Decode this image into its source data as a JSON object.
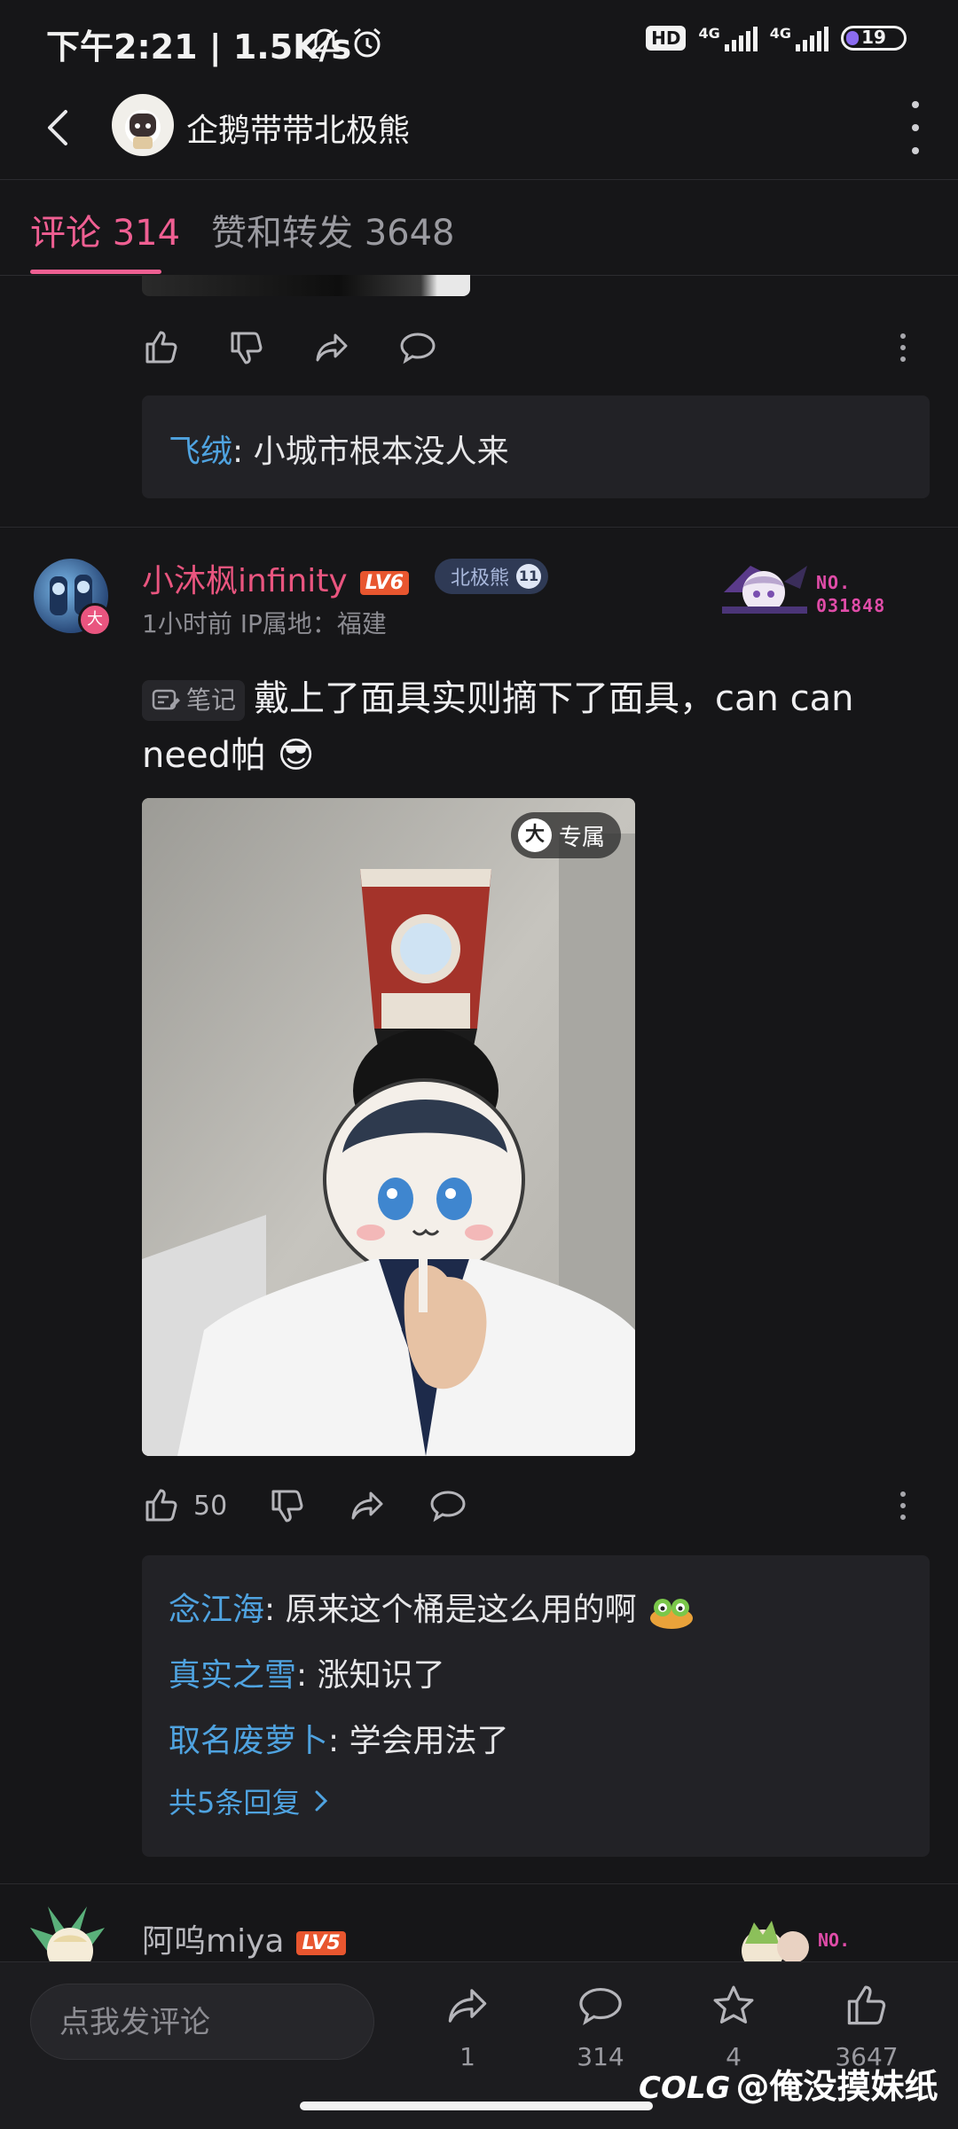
{
  "status": {
    "time": "下午2:21 | 1.5K/s",
    "network_hd": "HD",
    "net1": "4G",
    "net2": "4G",
    "battery": "19"
  },
  "header": {
    "title": "企鹅带带北极熊"
  },
  "tabs": {
    "comments": "评论 314",
    "likes": "赞和转发 3648"
  },
  "top_reply": {
    "name": "飞绒",
    "text": ": 小城市根本没人来"
  },
  "comment": {
    "username": "小沐枫infinity",
    "level": "LV6",
    "fan_label": "北极熊",
    "fan_level": "11",
    "avatar_badge": "大",
    "meta": "1小时前  IP属地：福建",
    "card_no": "NO.",
    "card_num": "031848",
    "tag": "笔记",
    "text": "戴上了面具实则摘下了面具，can can need帕",
    "emoji": "😎",
    "image_badge_icon": "大",
    "image_badge": "专属",
    "like_count": "50",
    "replies": [
      {
        "name": "念江海",
        "text": ": 原来这个桶是这么用的啊"
      },
      {
        "name": "真实之雪",
        "text": ": 涨知识了"
      },
      {
        "name": "取名废萝卜",
        "text": ": 学会用法了"
      }
    ],
    "more_replies": "共5条回复"
  },
  "next_comment": {
    "username": "阿呜miya",
    "level": "LV5",
    "card_no": "NO."
  },
  "bottom": {
    "placeholder": "点我发评论",
    "share_count": "1",
    "comment_count": "314",
    "star_count": "4",
    "like_count": "3647"
  },
  "watermark": {
    "logo": "COLG",
    "text": "@俺没摸妹纸"
  },
  "colors": {
    "accent": "#ef5f92",
    "link": "#4fa3e0",
    "background": "#161618"
  }
}
